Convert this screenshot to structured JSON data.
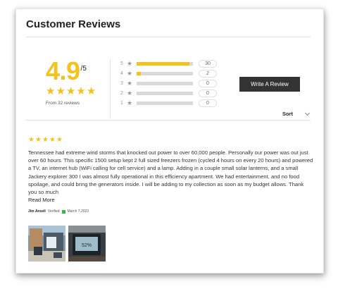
{
  "header": {
    "title": "Customer Reviews"
  },
  "summary": {
    "score": "4.9",
    "max": "/5",
    "stars": 5,
    "from_text": "From 32 reviews"
  },
  "breakdown": [
    {
      "label": "5",
      "count": "30",
      "fraction": 0.94
    },
    {
      "label": "4",
      "count": "2",
      "fraction": 0.07
    },
    {
      "label": "3",
      "count": "0",
      "fraction": 0
    },
    {
      "label": "2",
      "count": "0",
      "fraction": 0
    },
    {
      "label": "1",
      "count": "0",
      "fraction": 0
    }
  ],
  "actions": {
    "write_review": "Write A Review",
    "sort_label": "Sort"
  },
  "review": {
    "stars": 5,
    "body": "Tennessee had extreme wind storms that knocked out power to over 60,000 people. Personally our power was out just over 60 hours. This specific 1500 setup kept 2 full sized freezers frozen (cycled 4 hours on every 20 hours) and powered a TV, an internet hub (WiFi calling for cell service) and a lamp. Adding in a couple small solar lanterns, and a small Jackery explorer 300 I was almost fully operational in this efficiency apartment. We had entertainment, and no food spoilage, and could bring the generators inside. I will be adding to my collection as soon as my budget allows. Thank you so much",
    "read_more": "Read More",
    "author": "Jim Ansell",
    "verified": "Verified",
    "date": "March 7,2023"
  },
  "thumbs": {
    "display_reading": "52%"
  },
  "colors": {
    "accent": "#f4c21c",
    "button": "#333333",
    "verified": "#3bb54a"
  }
}
